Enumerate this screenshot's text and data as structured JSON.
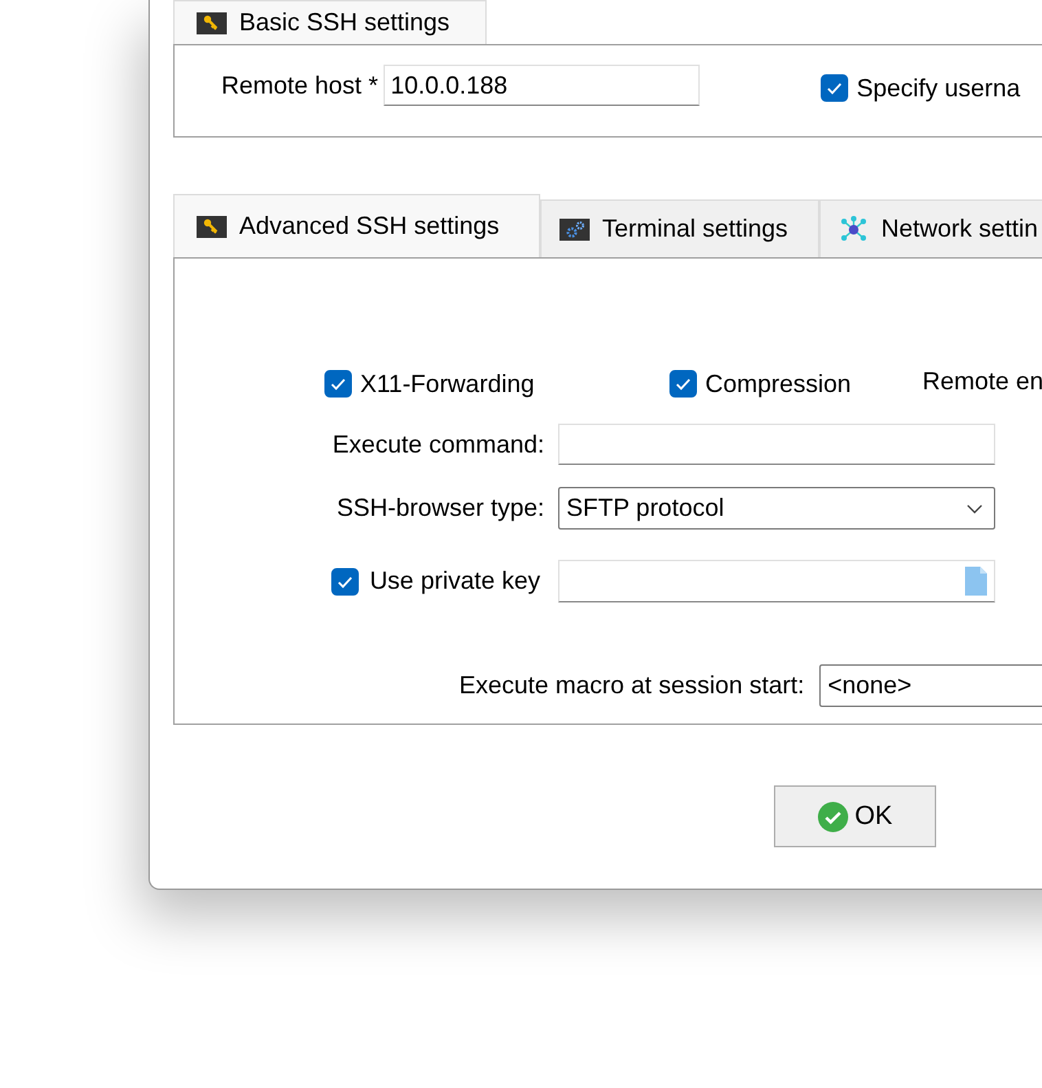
{
  "basic_tab": {
    "label": "Basic SSH settings",
    "selected": true
  },
  "basic": {
    "remote_host": {
      "label": "Remote host *",
      "value": "10.0.0.188"
    },
    "specify_username": {
      "label": "Specify userna",
      "checked": true
    }
  },
  "tabs": [
    {
      "label": "Advanced SSH settings",
      "selected": true
    },
    {
      "label": "Terminal settings",
      "selected": false
    },
    {
      "label": "Network settin",
      "selected": false
    }
  ],
  "advanced": {
    "options": [
      {
        "label": "X11-Forwarding",
        "checked": true
      },
      {
        "label": "Compression",
        "checked": true
      }
    ],
    "remote_env_label": "Remote en",
    "execute_command": {
      "label": "Execute command:"
    },
    "ssh_browser_type": {
      "label": "SSH-browser type:",
      "value": "SFTP protocol"
    },
    "private_key": {
      "label": "Use private key",
      "checked": true
    },
    "macro": {
      "label": "Execute macro at session start:",
      "value": "<none>"
    }
  },
  "ok_button": "OK"
}
